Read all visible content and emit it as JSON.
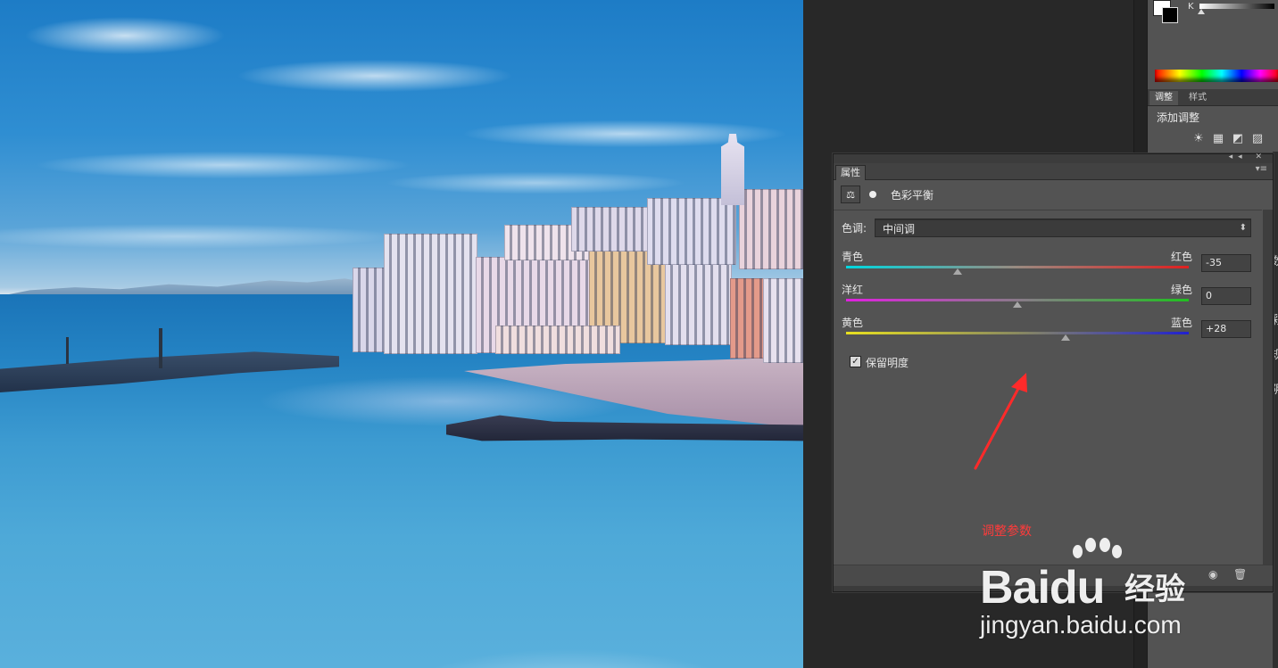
{
  "right_panel": {
    "k_label": "K",
    "tabs": [
      "调整",
      "样式"
    ],
    "add_adjustment": "添加调整",
    "adjustment_icons": [
      "☀",
      "▦",
      "◩",
      "▨"
    ],
    "cut_glyphs": [
      "数",
      "彩",
      "规",
      "阴"
    ]
  },
  "properties": {
    "tab_label": "属性",
    "title": "色彩平衡",
    "tone": {
      "label": "色调:",
      "value": "中间调"
    },
    "sliders": [
      {
        "left": "青色",
        "right": "红色",
        "value": "-35",
        "level": -35
      },
      {
        "left": "洋红",
        "right": "绿色",
        "value": "0",
        "level": 0
      },
      {
        "left": "黄色",
        "right": "蓝色",
        "value": "+28",
        "level": 28
      }
    ],
    "preserve_luminosity": {
      "label": "保留明度",
      "checked": true
    },
    "footer_icons": [
      "eye-icon",
      "trash-icon"
    ]
  },
  "annotation": {
    "text": "调整参数",
    "color": "#ff3b3b"
  },
  "watermark": {
    "brand": "Bai",
    "brand_tail": "du",
    "cn": "经验",
    "url": "jingyan.baidu.com"
  },
  "colors": {
    "workspace": "#282828",
    "panel": "#535353",
    "annotation": "#ff3b3b"
  }
}
